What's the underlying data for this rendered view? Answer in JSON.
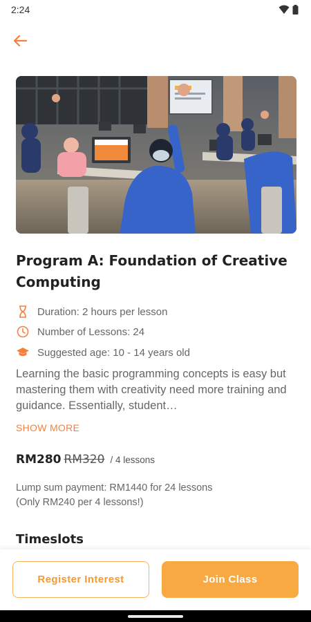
{
  "status_bar": {
    "time": "2:24",
    "icons": [
      "wifi-icon",
      "battery-icon"
    ]
  },
  "header": {
    "back_icon": "arrow-left-icon"
  },
  "hero_image": {
    "description_icon": "classroom-photo"
  },
  "program": {
    "title": "Program A: Foundation of Creative Computing",
    "duration": "Duration: 2 hours per lesson",
    "lessons": "Number of Lessons: 24",
    "age": "Suggested age: 10 - 14 years old",
    "description": "Learning the basic programming concepts is easy but mastering them with creativity need more training and guidance. Essentially, student…",
    "show_more": "SHOW MORE"
  },
  "pricing": {
    "current": "RM280",
    "original": "RM320",
    "unit": "/ 4 lessons",
    "lump_line1": "Lump sum payment: RM1440 for 24 lessons",
    "lump_line2": "(Only RM240 per 4 lessons!)"
  },
  "sections": {
    "timeslots": "Timeslots"
  },
  "actions": {
    "register": "Register Interest",
    "join": "Join Class"
  },
  "colors": {
    "accent": "#f5803e",
    "button_primary": "#f9a942",
    "button_outline": "#f8b25a"
  }
}
